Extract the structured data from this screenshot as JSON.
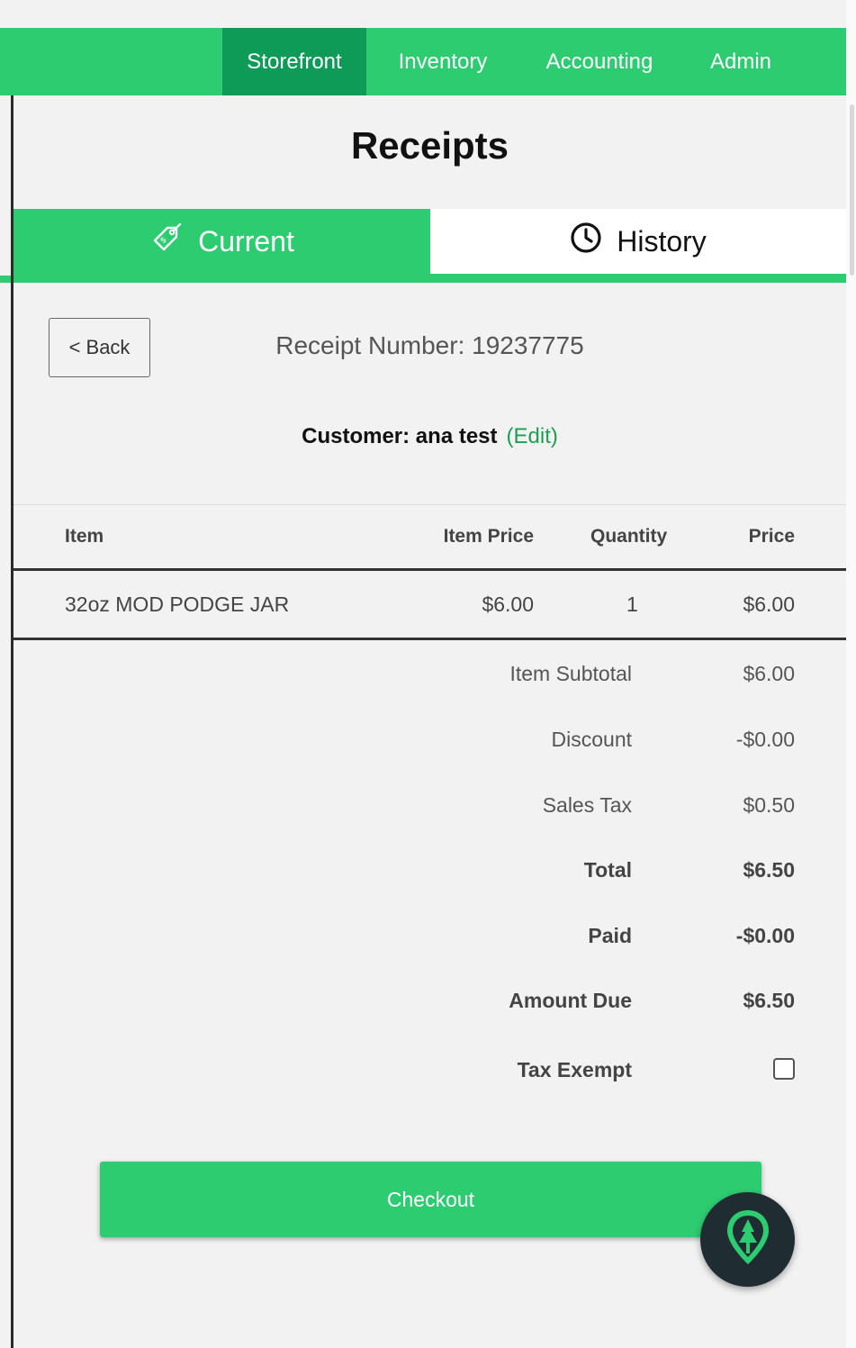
{
  "nav": {
    "tabs": [
      {
        "label": "Storefront",
        "active": true
      },
      {
        "label": "Inventory",
        "active": false
      },
      {
        "label": "Accounting",
        "active": false
      },
      {
        "label": "Admin",
        "active": false
      }
    ]
  },
  "page": {
    "title": "Receipts"
  },
  "receipt_tabs": {
    "current": {
      "label": "Current",
      "icon": "price-tag-icon"
    },
    "history": {
      "label": "History",
      "icon": "clock-icon"
    }
  },
  "receipt": {
    "back_label": "< Back",
    "number_text": "Receipt Number: 19237775",
    "customer_label": "Customer: ana test",
    "edit_label": "(Edit)"
  },
  "table": {
    "headers": {
      "item": "Item",
      "item_price": "Item Price",
      "quantity": "Quantity",
      "price": "Price"
    },
    "rows": [
      {
        "item": "32oz MOD PODGE JAR",
        "item_price": "$6.00",
        "quantity": "1",
        "price": "$6.00"
      }
    ]
  },
  "summary": {
    "subtotal_label": "Item Subtotal",
    "subtotal_value": "$6.00",
    "discount_label": "Discount",
    "discount_value": "-$0.00",
    "tax_label": "Sales Tax",
    "tax_value": "$0.50",
    "total_label": "Total",
    "total_value": "$6.50",
    "paid_label": "Paid",
    "paid_value": "-$0.00",
    "due_label": "Amount Due",
    "due_value": "$6.50",
    "tax_exempt_label": "Tax Exempt",
    "tax_exempt_checked": false
  },
  "actions": {
    "checkout_label": "Checkout"
  },
  "fab": {
    "icon": "tree-location-icon"
  },
  "colors": {
    "accent": "#2ecc71",
    "accent_dark": "#0e9b57",
    "link": "#1e9e55",
    "fab_bg": "#1f2d33"
  }
}
